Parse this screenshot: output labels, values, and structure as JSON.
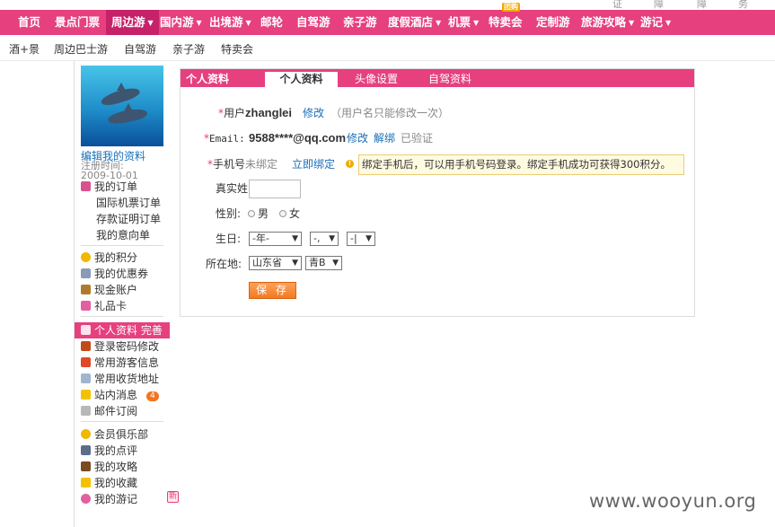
{
  "top_strip": [
    "证",
    "障",
    "障",
    "务"
  ],
  "main_nav": [
    {
      "label": "首页",
      "caret": false
    },
    {
      "label": "景点门票",
      "caret": false
    },
    {
      "label": "周边游",
      "caret": true,
      "active": true
    },
    {
      "label": "国内游",
      "caret": true
    },
    {
      "label": "出境游",
      "caret": true
    },
    {
      "label": "邮轮",
      "caret": false
    },
    {
      "label": "自驾游",
      "caret": false
    },
    {
      "label": "亲子游",
      "caret": false
    },
    {
      "label": "度假酒店",
      "caret": true
    },
    {
      "label": "机票",
      "caret": true
    },
    {
      "label": "特卖会",
      "caret": false,
      "badge": "团购"
    },
    {
      "label": "定制游",
      "caret": false
    },
    {
      "label": "旅游攻略",
      "caret": true
    },
    {
      "label": "游记",
      "caret": true
    }
  ],
  "caret_glyph": "▼",
  "sub_nav": [
    "酒+景",
    "周边巴士游",
    "自驾游",
    "亲子游",
    "特卖会"
  ],
  "sidebar": {
    "edit_profile": "编辑我的资料",
    "reg_label": "注册时间:",
    "reg_date": "2009-10-01",
    "group1": [
      {
        "label": "我的订单",
        "icon": "order-icon",
        "sub": false
      },
      {
        "label": "国际机票订单",
        "sub": true
      },
      {
        "label": "存款证明订单",
        "sub": true
      },
      {
        "label": "我的意向单",
        "sub": true
      }
    ],
    "group2": [
      {
        "label": "我的积分",
        "icon": "points-icon"
      },
      {
        "label": "我的优惠券",
        "icon": "coupon-icon"
      },
      {
        "label": "现金账户",
        "icon": "cash-icon"
      },
      {
        "label": "礼品卡",
        "icon": "giftcard-icon"
      }
    ],
    "group3": [
      {
        "label": "个人资料 完善",
        "icon": "profile-icon",
        "active": true
      },
      {
        "label": "登录密码修改",
        "icon": "password-icon"
      },
      {
        "label": "常用游客信息",
        "icon": "traveler-icon"
      },
      {
        "label": "常用收货地址",
        "icon": "address-icon"
      },
      {
        "label": "站内消息",
        "icon": "message-icon",
        "badge": "4"
      },
      {
        "label": "邮件订阅",
        "icon": "mail-icon"
      }
    ],
    "group4": [
      {
        "label": "会员俱乐部",
        "icon": "club-icon"
      },
      {
        "label": "我的点评",
        "icon": "review-icon"
      },
      {
        "label": "我的攻略",
        "icon": "guide-icon"
      },
      {
        "label": "我的收藏",
        "icon": "favorite-icon"
      },
      {
        "label": "我的游记",
        "icon": "travelnote-icon",
        "badge": "新"
      }
    ]
  },
  "panel": {
    "title": "个人资料",
    "tabs": [
      "个人资料",
      "头像设置",
      "自驾资料"
    ],
    "required_mark": "*",
    "username_label": "用户",
    "username": "zhanglei",
    "username_edit": "修改",
    "username_note": "（用户名只能修改一次）",
    "email_label": "Email:",
    "email": "9588****@qq.com",
    "email_edit": "修改",
    "email_unbind": "解绑",
    "email_status": "已验证",
    "phone_label": "手机号",
    "phone_status": "未绑定",
    "phone_bind": "立即绑定",
    "tip_mark": "!",
    "phone_tip": "绑定手机后，可以用手机号码登录。绑定手机成功可获得300积分。",
    "realname_label": "真实姓",
    "realname_value": "",
    "gender_label": "性别:",
    "gender_options": [
      "男",
      "女"
    ],
    "birthday_label": "生日:",
    "birthday_year": "-年-",
    "birthday_month": "-,",
    "birthday_day": "-|",
    "location_label": "所在地:",
    "province": "山东省",
    "city": "青B",
    "save": "保 存"
  },
  "watermark": "www.wooyun.org"
}
